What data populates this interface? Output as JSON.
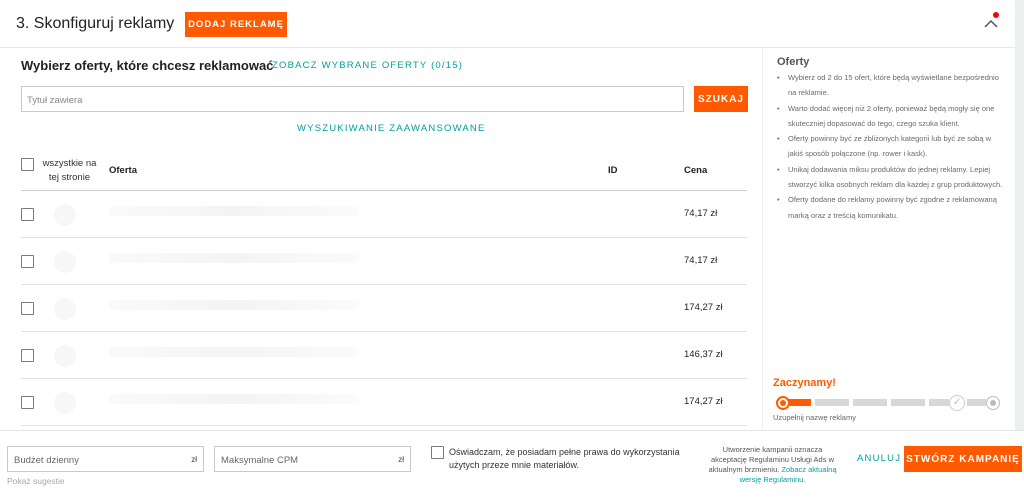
{
  "header": {
    "title": "3. Skonfiguruj reklamy",
    "add_button": "DODAJ REKLAMĘ",
    "collapse_icon": "chevron-up-icon",
    "notification_color": "#ff0000"
  },
  "offers": {
    "heading": "Wybierz oferty, które chcesz reklamować",
    "view_selected": "ZOBACZ WYBRANE OFERTY (0/15)",
    "search_placeholder": "Tytuł zawiera",
    "search_button": "SZUKAJ",
    "advanced_search": "WYSZUKIWANIE ZAAWANSOWANE",
    "columns": {
      "all_on_page": "wszystkie na tej stronie",
      "offer": "Oferta",
      "id": "ID",
      "price": "Cena"
    },
    "rows": [
      {
        "price": "74,17 zł"
      },
      {
        "price": "74,17 zł"
      },
      {
        "price": "174,27 zł"
      },
      {
        "price": "146,37 zł"
      },
      {
        "price": "174,27 zł"
      }
    ]
  },
  "sidebar": {
    "title": "Oferty",
    "tips": [
      "Wybierz od 2 do 15 ofert, które będą wyświetlane bezpośrednio na reklamie.",
      "Warto dodać więcej niż 2 oferty, ponieważ będą mogły się one skuteczniej dopasować do tego, czego szuka klient.",
      "Oferty powinny być ze zbliżonych kategorii lub być ze sobą w jakiś sposób połączone (np. rower i kask).",
      "Unikaj dodawania miksu produktów do jednej reklamy. Lepiej stworzyć kilka osobnych reklam dla każdej z grup produktowych.",
      "Oferty dodane do reklamy powinny być zgodne z reklamowaną marką oraz z treścią komunikatu."
    ]
  },
  "progress": {
    "title": "Zaczynamy!",
    "hint": "Uzupełnij nazwę reklamy",
    "completed_steps": 1,
    "total_steps": 6,
    "accent": "#ff5a00"
  },
  "footer": {
    "budget_placeholder": "Budżet dzienny",
    "budget_unit": "zł",
    "cpm_placeholder": "Maksymalne CPM",
    "cpm_unit": "zł",
    "suggestions_link": "Pokaż sugestie",
    "consent": "Oświadczam, że posiadam pełne prawa do wykorzystania użytych przeze mnie materiałów.",
    "legal_text": "Utworzenie kampanii oznacza akceptację Regulaminu Usługi Ads w aktualnym brzmieniu.",
    "legal_link": "Zobacz aktualną wersję Regulaminu.",
    "cancel": "ANULUJ",
    "create": "STWÓRZ KAMPANIĘ"
  }
}
